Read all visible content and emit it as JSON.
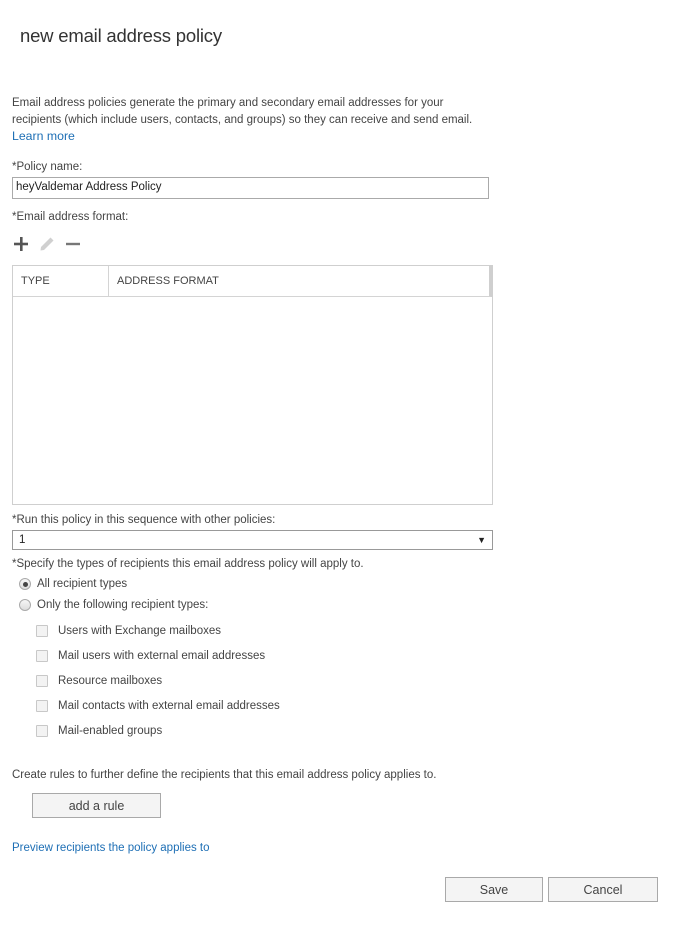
{
  "dialog": {
    "title": "new email address policy"
  },
  "intro": {
    "description": "Email address policies generate the primary and secondary email addresses for your recipients (which include users, contacts, and groups) so they can receive and send email.",
    "learn_more": "Learn more"
  },
  "policy_name": {
    "label": "*Policy name:",
    "value": "heyValdemar Address Policy"
  },
  "email_format": {
    "label": "*Email address format:",
    "toolbar": [
      {
        "icon": "plus-icon",
        "label": "Add",
        "enabled": true
      },
      {
        "icon": "pencil-icon",
        "label": "Edit",
        "enabled": false
      },
      {
        "icon": "minus-icon",
        "label": "Remove",
        "enabled": true
      }
    ],
    "columns": [
      "TYPE",
      "ADDRESS FORMAT"
    ],
    "rows": []
  },
  "sequence": {
    "label": "*Run this policy in this sequence with other policies:",
    "selected": "1"
  },
  "recipients": {
    "label": "*Specify the types of recipients this email address policy will apply to.",
    "options": [
      {
        "label": "All recipient types",
        "selected": true
      },
      {
        "label": "Only the following recipient types:",
        "selected": false
      }
    ],
    "types": [
      {
        "label": "Users with Exchange mailboxes",
        "checked": false
      },
      {
        "label": "Mail users with external email addresses",
        "checked": false
      },
      {
        "label": "Resource mailboxes",
        "checked": false
      },
      {
        "label": "Mail contacts with external email addresses",
        "checked": false
      },
      {
        "label": "Mail-enabled groups",
        "checked": false
      }
    ]
  },
  "rules": {
    "description": "Create rules to further define the recipients that this email address policy applies to.",
    "add_rule": "add a rule"
  },
  "preview_link": "Preview recipients the policy applies to",
  "footer": {
    "save": "Save",
    "cancel": "Cancel"
  },
  "colors": {
    "link": "#1e6fb5",
    "text": "#444444",
    "border": "#a9a9a9",
    "button_bg": "#f4f4f4"
  }
}
